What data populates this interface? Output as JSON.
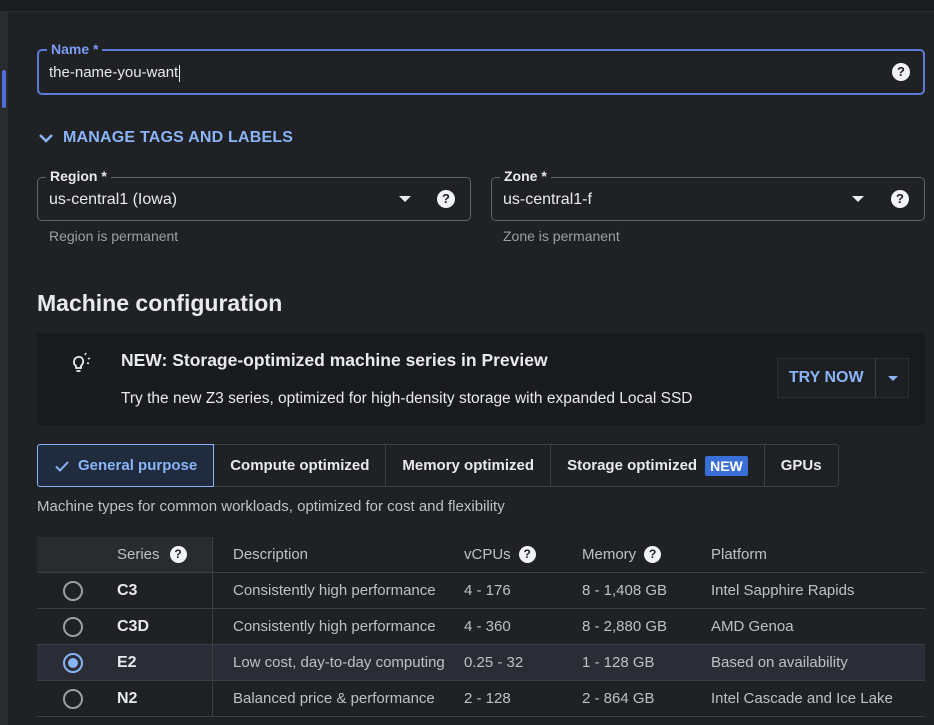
{
  "name_field": {
    "label": "Name *",
    "value": "the-name-you-want"
  },
  "tags_toggle": {
    "label": "MANAGE TAGS AND LABELS"
  },
  "region": {
    "label": "Region *",
    "value": "us-central1 (Iowa)",
    "hint": "Region is permanent"
  },
  "zone": {
    "label": "Zone *",
    "value": "us-central1-f",
    "hint": "Zone is permanent"
  },
  "machine_config": {
    "title": "Machine configuration"
  },
  "promo": {
    "icon": "lightbulb-icon",
    "title": "NEW: Storage-optimized machine series in Preview",
    "description": "Try the new Z3 series, optimized for high-density storage with expanded Local SSD",
    "button": "TRY NOW"
  },
  "tabs": [
    {
      "label": "General purpose",
      "active": true
    },
    {
      "label": "Compute optimized"
    },
    {
      "label": "Memory optimized"
    },
    {
      "label": "Storage optimized",
      "badge": "NEW"
    },
    {
      "label": "GPUs"
    }
  ],
  "tab_description": "Machine types for common workloads, optimized for cost and flexibility",
  "table": {
    "headers": {
      "series": "Series",
      "description": "Description",
      "vcpus": "vCPUs",
      "memory": "Memory",
      "platform": "Platform"
    },
    "rows": [
      {
        "series": "C3",
        "description": "Consistently high performance",
        "vcpus": "4 - 176",
        "memory": "8 - 1,408 GB",
        "platform": "Intel Sapphire Rapids",
        "selected": false
      },
      {
        "series": "C3D",
        "description": "Consistently high performance",
        "vcpus": "4 - 360",
        "memory": "8 - 2,880 GB",
        "platform": "AMD Genoa",
        "selected": false
      },
      {
        "series": "E2",
        "description": "Low cost, day-to-day computing",
        "vcpus": "0.25 - 32",
        "memory": "1 - 128 GB",
        "platform": "Based on availability",
        "selected": true
      },
      {
        "series": "N2",
        "description": "Balanced price & performance",
        "vcpus": "2 - 128",
        "memory": "2 - 864 GB",
        "platform": "Intel Cascade and Ice Lake",
        "selected": false
      }
    ]
  },
  "help_glyph": "?",
  "colors": {
    "accent": "#8ab4f8",
    "focus_border": "#5b7bd9",
    "badge": "#3b6fd8",
    "background": "#202124"
  }
}
